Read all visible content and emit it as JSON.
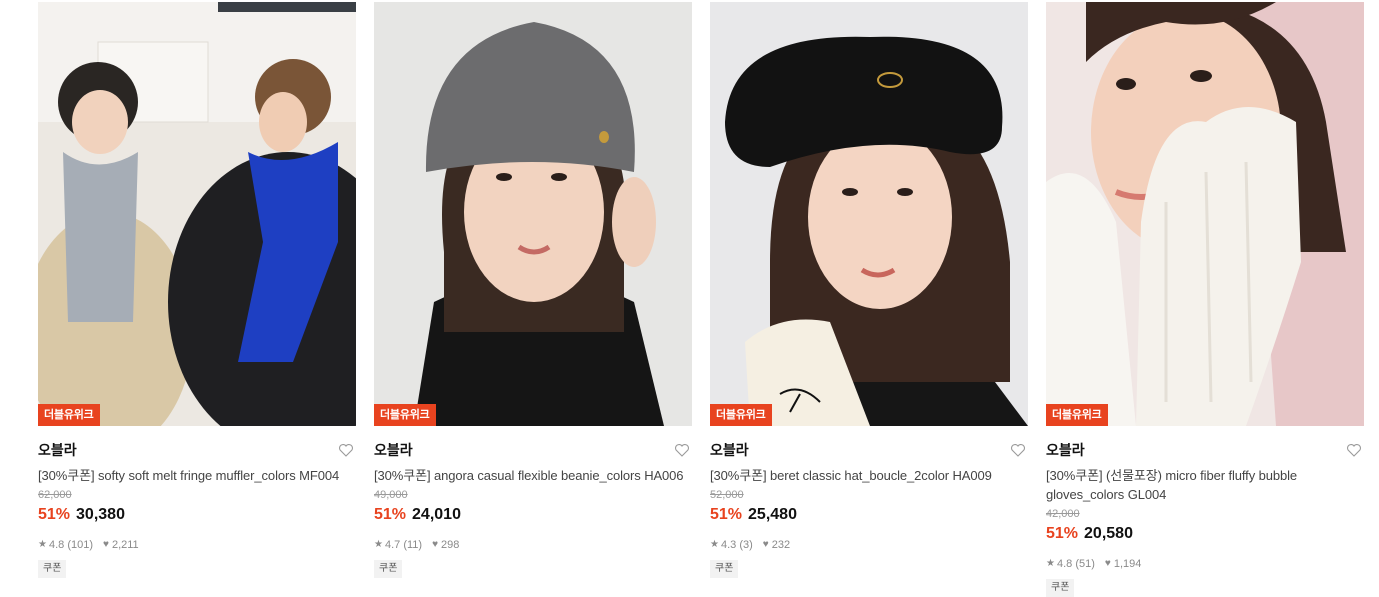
{
  "products": [
    {
      "badge": "더블유위크",
      "brand": "오블라",
      "title": "[30%쿠폰] softy soft melt fringe muffler_colors MF004",
      "original_price": "62,000",
      "discount_rate": "51%",
      "price": "30,380",
      "rating": "4.8",
      "review_count": "(101)",
      "likes": "2,211",
      "tag": "쿠폰",
      "image_subject": "two people wearing fringe mufflers (grey and blue)"
    },
    {
      "badge": "더블유위크",
      "brand": "오블라",
      "title": "[30%쿠폰] angora casual flexible beanie_colors HA006",
      "original_price": "49,000",
      "discount_rate": "51%",
      "price": "24,010",
      "rating": "4.7",
      "review_count": "(11)",
      "likes": "298",
      "tag": "쿠폰",
      "image_subject": "model wearing a grey angora beanie"
    },
    {
      "badge": "더블유위크",
      "brand": "오블라",
      "title": "[30%쿠폰] beret classic hat_boucle_2color HA009",
      "original_price": "52,000",
      "discount_rate": "51%",
      "price": "25,480",
      "rating": "4.3",
      "review_count": "(3)",
      "likes": "232",
      "tag": "쿠폰",
      "image_subject": "model wearing a black boucle beret"
    },
    {
      "badge": "더블유위크",
      "brand": "오블라",
      "title": "[30%쿠폰] (선물포장) micro fiber fluffy bubble gloves_colors GL004",
      "original_price": "42,000",
      "discount_rate": "51%",
      "price": "20,580",
      "rating": "4.8",
      "review_count": "(51)",
      "likes": "1,194",
      "tag": "쿠폰",
      "image_subject": "model wearing white fluffy gloves"
    }
  ],
  "icons": {
    "wishlist": "heart-outline-icon",
    "rating": "star-icon",
    "likes": "heart-filled-icon"
  },
  "colors": {
    "accent": "#e8431f",
    "text": "#111111",
    "muted": "#8a8a8a"
  }
}
